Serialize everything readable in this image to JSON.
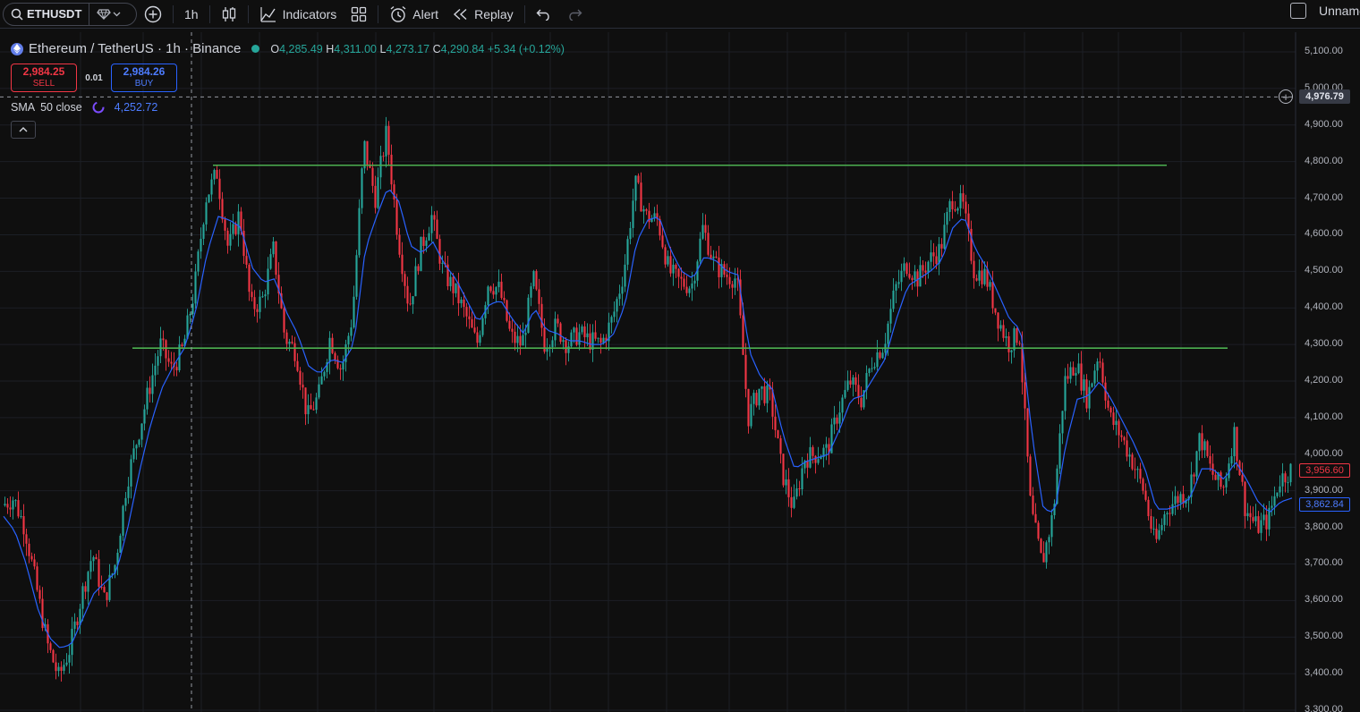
{
  "toolbar": {
    "symbol": "ETHUSDT",
    "interval": "1h",
    "indicators_label": "Indicators",
    "alert_label": "Alert",
    "replay_label": "Replay",
    "layout_name": "Unnamed"
  },
  "legend": {
    "title": "Ethereum / TetherUS · 1h · Binance",
    "o_label": "O",
    "o_value": "4,285.49",
    "h_label": "H",
    "h_value": "4,311.00",
    "l_label": "L",
    "l_value": "4,273.17",
    "c_label": "C",
    "c_value": "4,290.84",
    "change": "+5.34 (+0.12%)"
  },
  "trade": {
    "sell_price": "2,984.25",
    "sell_label": "SELL",
    "spread": "0.01",
    "buy_price": "2,984.26",
    "buy_label": "BUY"
  },
  "sma": {
    "name": "SMA",
    "params": "50 close",
    "value": "4,252.72"
  },
  "price_axis": {
    "ticks": [
      "5,100.00",
      "5,000.00",
      "4,900.00",
      "4,800.00",
      "4,700.00",
      "4,600.00",
      "4,500.00",
      "4,400.00",
      "4,300.00",
      "4,200.00",
      "4,100.00",
      "4,000.00",
      "3,900.00",
      "3,800.00",
      "3,700.00",
      "3,600.00",
      "3,500.00",
      "3,400.00",
      "3,300.00"
    ],
    "crosshair_price": "4,976.79",
    "last_price": "3,956.60",
    "sma_price": "3,862.84"
  },
  "colors": {
    "up": "#26a69a",
    "down": "#f23645",
    "sma": "#2962ff",
    "hline": "#4caf50",
    "background": "#0f0f0f"
  },
  "chart_data": {
    "type": "candlestick",
    "ylim": [
      3300,
      5100
    ],
    "horizontal_lines": [
      4790,
      4290
    ],
    "crosshair": 4976.79,
    "price_path": [
      3860,
      3880,
      3800,
      3640,
      3480,
      3390,
      3470,
      3610,
      3730,
      3600,
      3700,
      3920,
      4050,
      4180,
      4300,
      4230,
      4290,
      4450,
      4700,
      4770,
      4560,
      4660,
      4400,
      4420,
      4560,
      4320,
      4280,
      4100,
      4160,
      4320,
      4230,
      4380,
      4850,
      4700,
      4880,
      4600,
      4400,
      4560,
      4650,
      4500,
      4450,
      4380,
      4300,
      4470,
      4450,
      4320,
      4300,
      4480,
      4300,
      4350,
      4300,
      4330,
      4310,
      4300,
      4370,
      4500,
      4740,
      4650,
      4640,
      4500,
      4470,
      4460,
      4620,
      4520,
      4490,
      4480,
      4100,
      4180,
      4150,
      3950,
      3850,
      3990,
      4000,
      4010,
      4120,
      4200,
      4150,
      4260,
      4300,
      4450,
      4520,
      4480,
      4530,
      4560,
      4700,
      4680,
      4500,
      4490,
      4380,
      4300,
      4330,
      3850,
      3700,
      3840,
      4200,
      4250,
      4150,
      4280,
      4100,
      4050,
      3980,
      3900,
      3750,
      3850,
      3880,
      3900,
      4050,
      3950,
      3900,
      4060,
      3850,
      3800,
      3820,
      3930,
      3957
    ],
    "sma_path": [
      3830,
      3790,
      3700,
      3580,
      3500,
      3470,
      3480,
      3550,
      3620,
      3650,
      3680,
      3800,
      3950,
      4080,
      4180,
      4240,
      4290,
      4390,
      4550,
      4650,
      4640,
      4620,
      4510,
      4470,
      4480,
      4390,
      4330,
      4240,
      4220,
      4260,
      4250,
      4300,
      4560,
      4650,
      4730,
      4690,
      4570,
      4550,
      4580,
      4520,
      4480,
      4420,
      4360,
      4410,
      4420,
      4370,
      4330,
      4400,
      4340,
      4330,
      4310,
      4310,
      4300,
      4300,
      4330,
      4410,
      4580,
      4640,
      4650,
      4560,
      4500,
      4480,
      4540,
      4530,
      4500,
      4490,
      4280,
      4210,
      4180,
      4050,
      3960,
      3980,
      3990,
      4000,
      4070,
      4150,
      4160,
      4210,
      4260,
      4370,
      4460,
      4480,
      4500,
      4530,
      4620,
      4650,
      4560,
      4510,
      4440,
      4370,
      4340,
      4050,
      3850,
      3840,
      4030,
      4150,
      4160,
      4200,
      4150,
      4090,
      4030,
      3960,
      3850,
      3850,
      3860,
      3880,
      3960,
      3960,
      3930,
      3980,
      3930,
      3870,
      3840,
      3870,
      3880
    ]
  }
}
